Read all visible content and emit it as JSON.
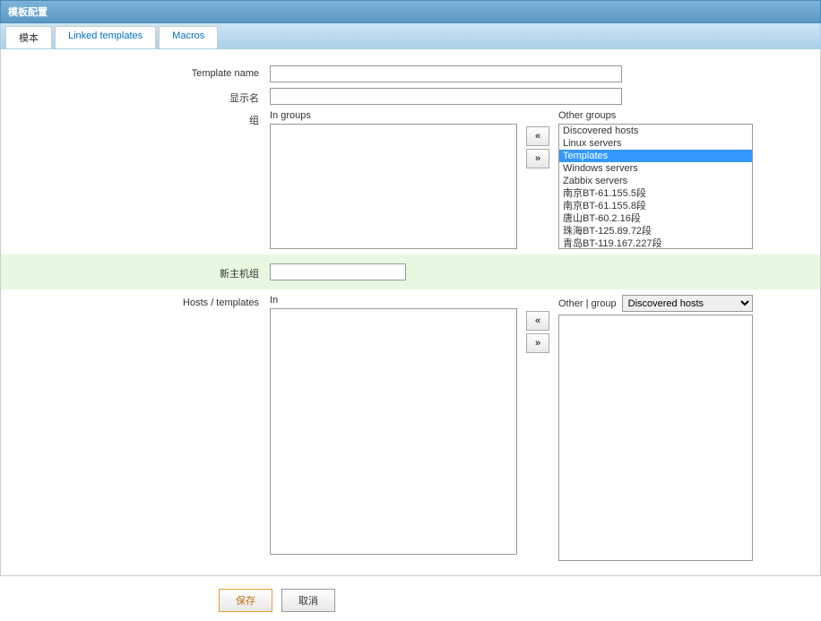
{
  "window_title": "模板配置",
  "tabs": [
    {
      "label": "模本"
    },
    {
      "label": "Linked templates"
    },
    {
      "label": "Macros"
    }
  ],
  "labels": {
    "template_name": "Template name",
    "visible_name": "显示名",
    "groups": "组",
    "new_group": "新主机组",
    "hosts_templates": "Hosts / templates",
    "in_groups": "In groups",
    "other_groups": "Other groups",
    "in": "In",
    "other_group": "Other | group"
  },
  "move": {
    "left": "«",
    "right": "»"
  },
  "values": {
    "template_name": "",
    "visible_name": "",
    "new_group": "",
    "other_group_selected": "Discovered hosts"
  },
  "in_groups_options": [],
  "other_groups_options": [
    {
      "label": "Discovered hosts",
      "selected": false
    },
    {
      "label": "Linux servers",
      "selected": false
    },
    {
      "label": "Templates",
      "selected": true
    },
    {
      "label": "Windows servers",
      "selected": false
    },
    {
      "label": "Zabbix servers",
      "selected": false
    },
    {
      "label": "南京BT-61.155.5段",
      "selected": false
    },
    {
      "label": "南京BT-61.155.8段",
      "selected": false
    },
    {
      "label": "唐山BT-60.2.16段",
      "selected": false
    },
    {
      "label": "珠海BT-125.89.72段",
      "selected": false
    },
    {
      "label": "青岛BT-119.167.227段",
      "selected": false
    }
  ],
  "in_hosts_options": [],
  "other_hosts_options": [],
  "other_group_dropdown_options": [
    "Discovered hosts"
  ],
  "buttons": {
    "save": "保存",
    "cancel": "取消"
  }
}
